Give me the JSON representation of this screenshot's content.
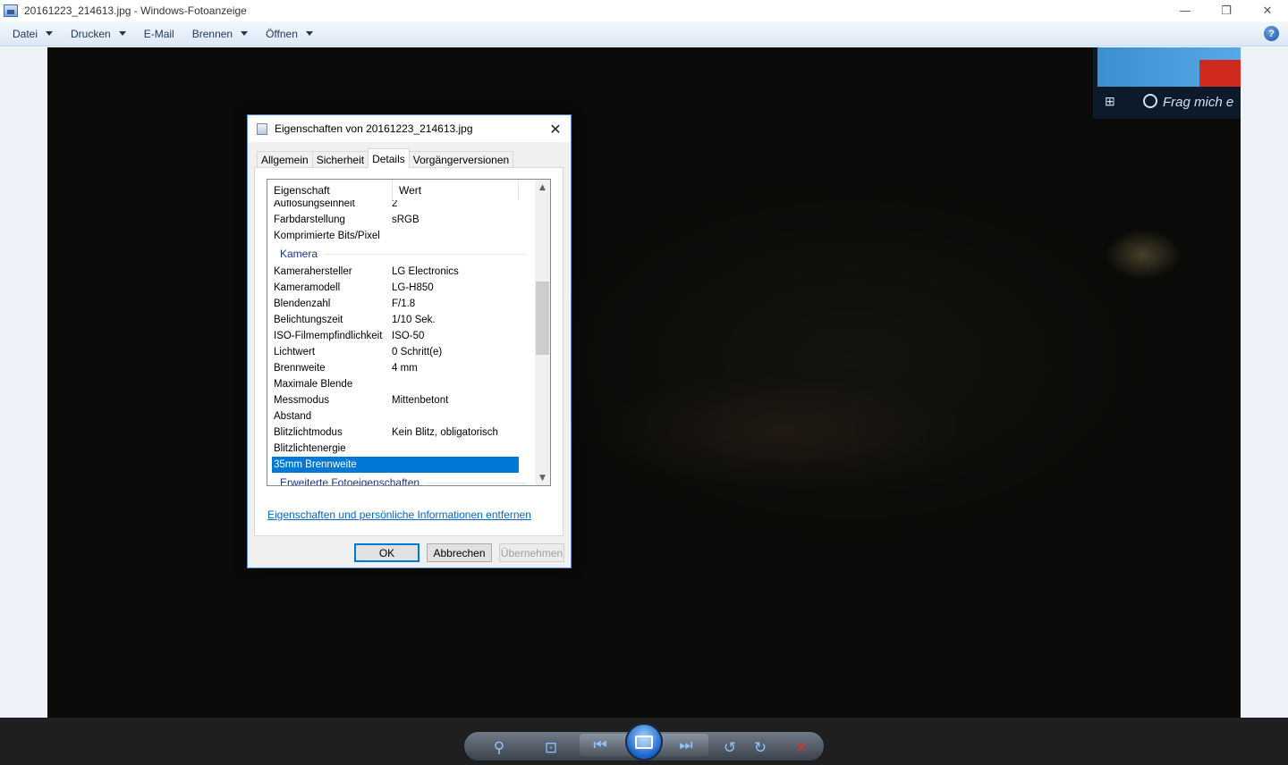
{
  "window": {
    "title": "20161223_214613.jpg - Windows-Fotoanzeige",
    "minimize": "—",
    "restore": "❐",
    "close": "✕"
  },
  "menu": {
    "items": [
      {
        "label": "Datei",
        "dropdown": true
      },
      {
        "label": "Drucken",
        "dropdown": true
      },
      {
        "label": "E-Mail",
        "dropdown": false
      },
      {
        "label": "Brennen",
        "dropdown": true
      },
      {
        "label": "Öffnen",
        "dropdown": true
      }
    ],
    "help": "?"
  },
  "photo": {
    "cortana_text": "Frag mich e",
    "windows_glyph": "⊞"
  },
  "dialog": {
    "title": "Eigenschaften von 20161223_214613.jpg",
    "close": "✕",
    "tabs": [
      "Allgemein",
      "Sicherheit",
      "Details",
      "Vorgängerversionen"
    ],
    "active_tab": "Details",
    "columns": {
      "property": "Eigenschaft",
      "value": "Wert"
    },
    "rows_before": [
      {
        "k": "Auflösungseinheit",
        "v": "2"
      },
      {
        "k": "Farbdarstellung",
        "v": "sRGB"
      },
      {
        "k": "Komprimierte Bits/Pixel",
        "v": ""
      }
    ],
    "group_camera": "Kamera",
    "camera_rows": [
      {
        "k": "Kamerahersteller",
        "v": "LG Electronics"
      },
      {
        "k": "Kameramodell",
        "v": "LG-H850"
      },
      {
        "k": "Blendenzahl",
        "v": "F/1.8"
      },
      {
        "k": "Belichtungszeit",
        "v": "1/10 Sek."
      },
      {
        "k": "ISO-Filmempfindlichkeit",
        "v": "ISO-50"
      },
      {
        "k": "Lichtwert",
        "v": "0 Schritt(e)"
      },
      {
        "k": "Brennweite",
        "v": "4 mm"
      },
      {
        "k": "Maximale Blende",
        "v": ""
      },
      {
        "k": "Messmodus",
        "v": "Mittenbetont"
      },
      {
        "k": "Abstand",
        "v": ""
      },
      {
        "k": "Blitzlichtmodus",
        "v": "Kein Blitz, obligatorisch"
      },
      {
        "k": "Blitzlichtenergie",
        "v": ""
      }
    ],
    "selected_row": {
      "k": "35mm Brennweite",
      "v": ""
    },
    "group_advanced": "Erweiterte Fotoeigenschaften",
    "remove_link": "Eigenschaften und persönliche Informationen entfernen",
    "buttons": {
      "ok": "OK",
      "cancel": "Abbrechen",
      "apply": "Übernehmen"
    }
  },
  "controls": {
    "zoom": "⚲",
    "actual_size": "⊡",
    "previous": "⏮",
    "next": "⏭",
    "rotate_ccw": "↺",
    "rotate_cw": "↻",
    "delete": "✕"
  }
}
